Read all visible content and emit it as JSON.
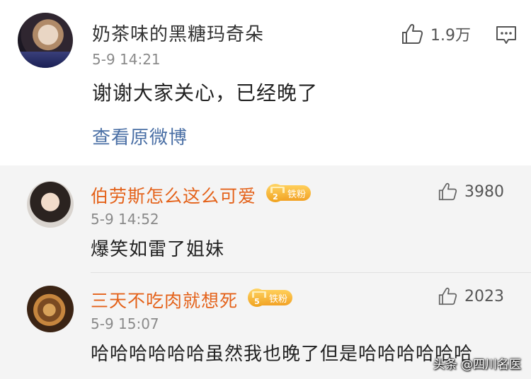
{
  "main_comment": {
    "username": "奶茶味的黑糖玛奇朵",
    "time": "5-9 14:21",
    "content": "谢谢大家关心，已经晚了",
    "view_original": "查看原微博",
    "likes": "1.9万",
    "icons": {
      "like": "thumbs-up-icon",
      "comment": "comment-icon"
    }
  },
  "replies": [
    {
      "username": "伯劳斯怎么这么可爱",
      "badge_level": "2",
      "badge_label": "铁粉",
      "time": "5-9 14:52",
      "content": "爆笑如雷了姐妹",
      "likes": "3980"
    },
    {
      "username": "三天不吃肉就想死",
      "badge_level": "5",
      "badge_label": "铁粉",
      "time": "5-9 15:07",
      "content": "哈哈哈哈哈哈虽然我也晚了但是哈哈哈哈哈哈",
      "likes": "2023"
    }
  ],
  "watermark": "头条 @四川名医",
  "colors": {
    "username_reply": "#e4621a",
    "link": "#4a6fa5",
    "reply_bg": "#f4f4f4",
    "badge": "#f2a225"
  }
}
